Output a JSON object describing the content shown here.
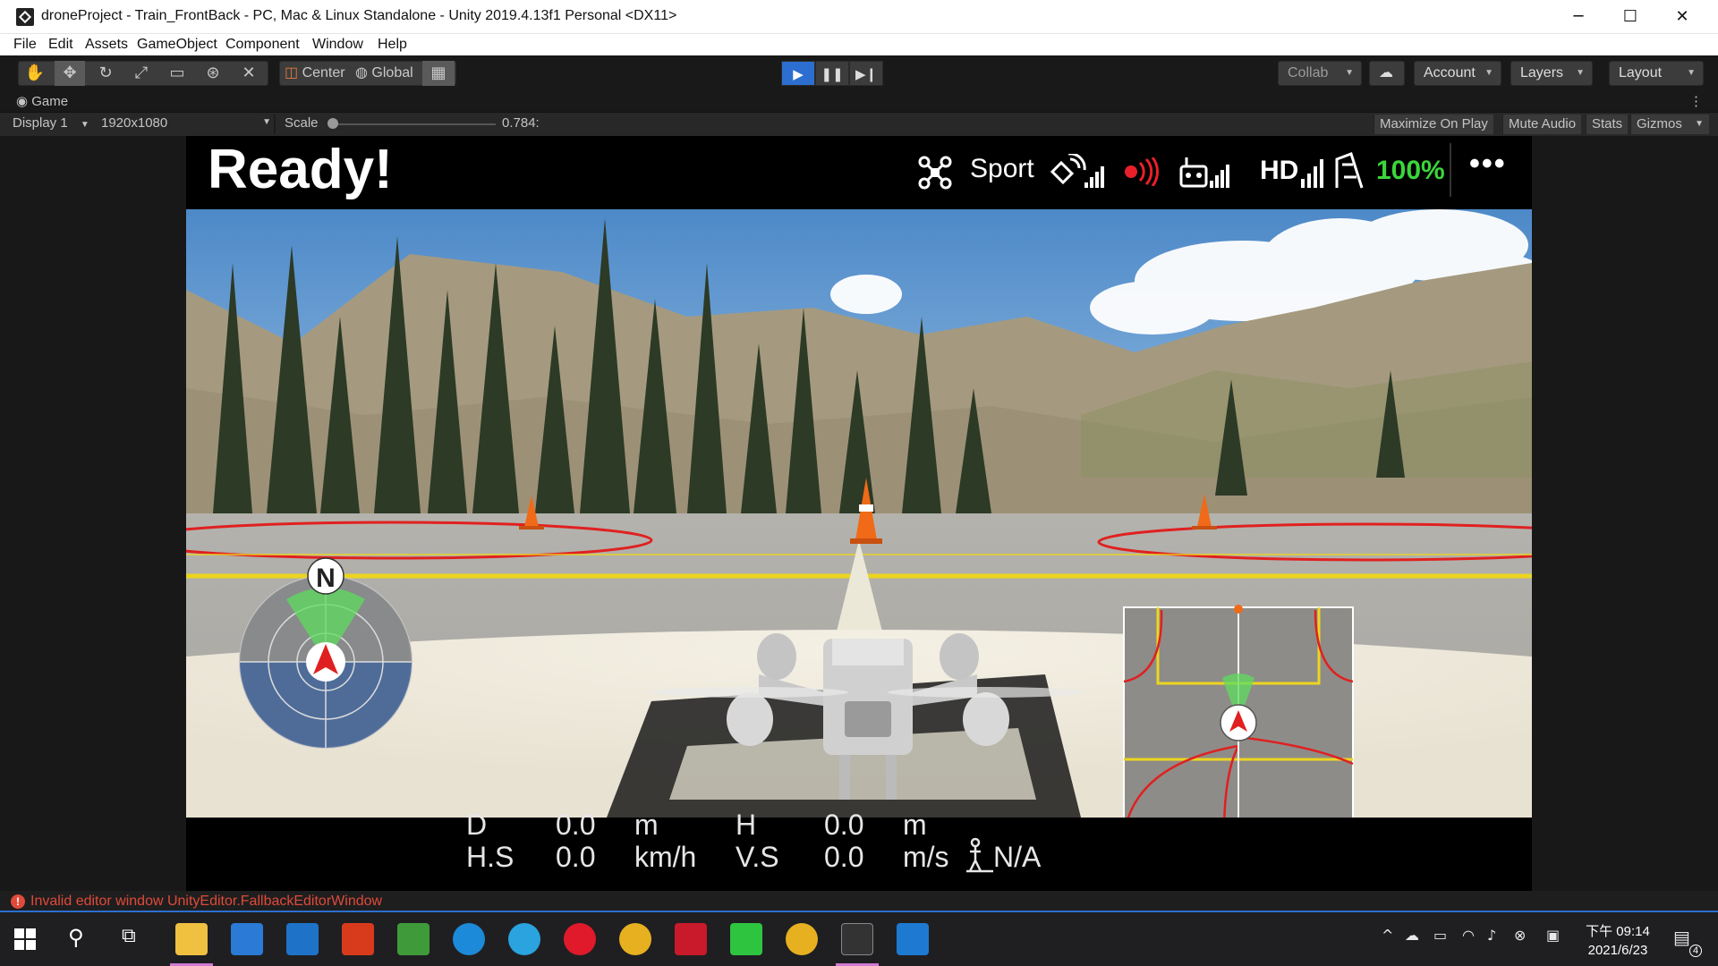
{
  "window": {
    "title": "droneProject - Train_FrontBack - PC, Mac & Linux Standalone - Unity 2019.4.13f1 Personal <DX11>",
    "minimize": "─",
    "maximize": "☐",
    "close": "✕"
  },
  "menu": [
    "File",
    "Edit",
    "Assets",
    "GameObject",
    "Component",
    "Window",
    "Help"
  ],
  "toolbar": {
    "pivot": "Center",
    "space": "Global",
    "collab": "Collab",
    "account": "Account",
    "layers": "Layers",
    "layout": "Layout"
  },
  "game_view": {
    "tab": "Game",
    "display": "Display 1",
    "resolution": "1920x1080",
    "scale_label": "Scale",
    "scale_value": "0.784:",
    "scale_level": 0.0,
    "maximize_on_play": "Maximize On Play",
    "mute_audio": "Mute Audio",
    "stats": "Stats",
    "gizmos": "Gizmos"
  },
  "hud": {
    "status": "Ready!",
    "mode": "Sport",
    "hd": "HD",
    "battery": "100%",
    "more": "•••",
    "compass_north": "N",
    "telemetry": {
      "d_label": "D",
      "d_value": "0.0",
      "d_unit": "m",
      "h_label": "H",
      "h_value": "0.0",
      "h_unit": "m",
      "hs_label": "H.S",
      "hs_value": "0.0",
      "hs_unit": "km/h",
      "vs_label": "V.S",
      "vs_value": "0.0",
      "vs_unit": "m/s",
      "vps_value": "N/A"
    }
  },
  "console": {
    "error": "Invalid editor window UnityEditor.FallbackEditorWindow"
  },
  "taskbar": {
    "clock_time": "下午 09:14",
    "clock_date": "2021/6/23",
    "notifications": "4"
  },
  "colors": {
    "accent_play": "#2d6fd0",
    "battery_green": "#3bd63b",
    "signal_red": "#e8202a",
    "error_red": "#e04a3a"
  }
}
